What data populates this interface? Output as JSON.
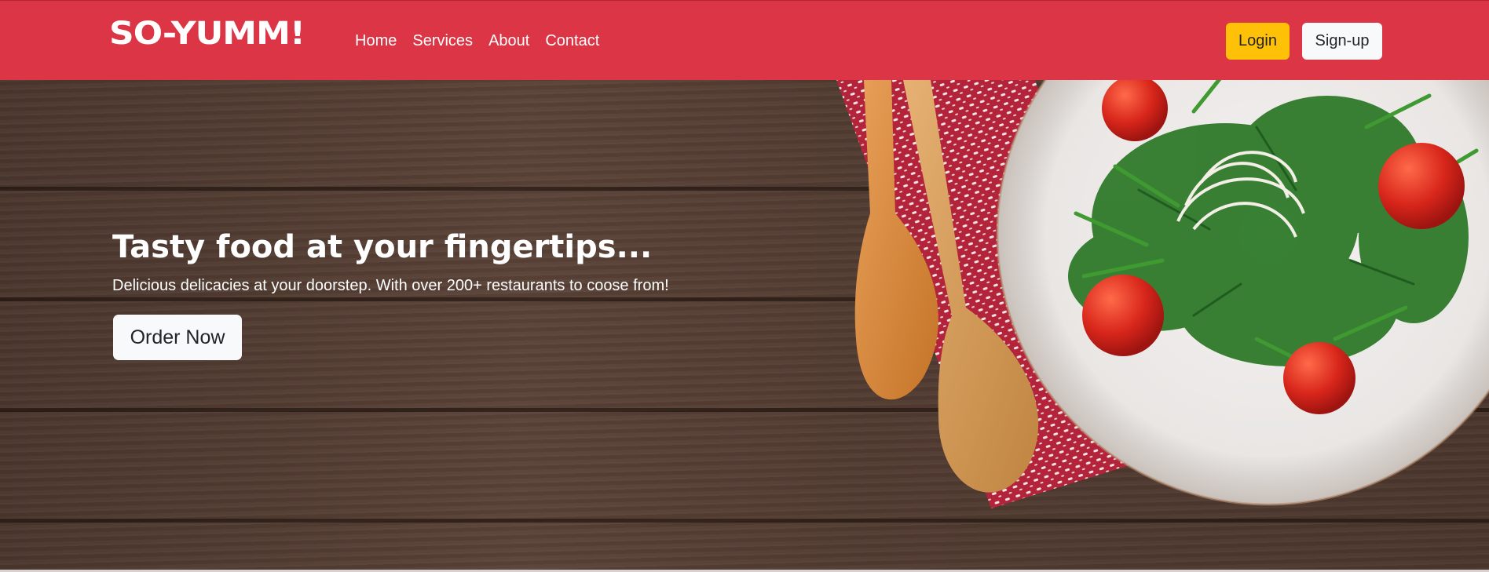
{
  "navbar": {
    "brand": "SO-YUMM!",
    "links": [
      "Home",
      "Services",
      "About",
      "Contact"
    ],
    "login_label": "Login",
    "signup_label": "Sign-up",
    "bg_color": "#dc3545",
    "login_color": "#ffc107"
  },
  "hero": {
    "title": "Tasty food at your fingertips...",
    "subtitle": "Delicious delicacies at your doorstep. With over 200+ restaurants to coose from!",
    "cta_label": "Order Now",
    "background_image": "wooden-table-salad-plate"
  }
}
